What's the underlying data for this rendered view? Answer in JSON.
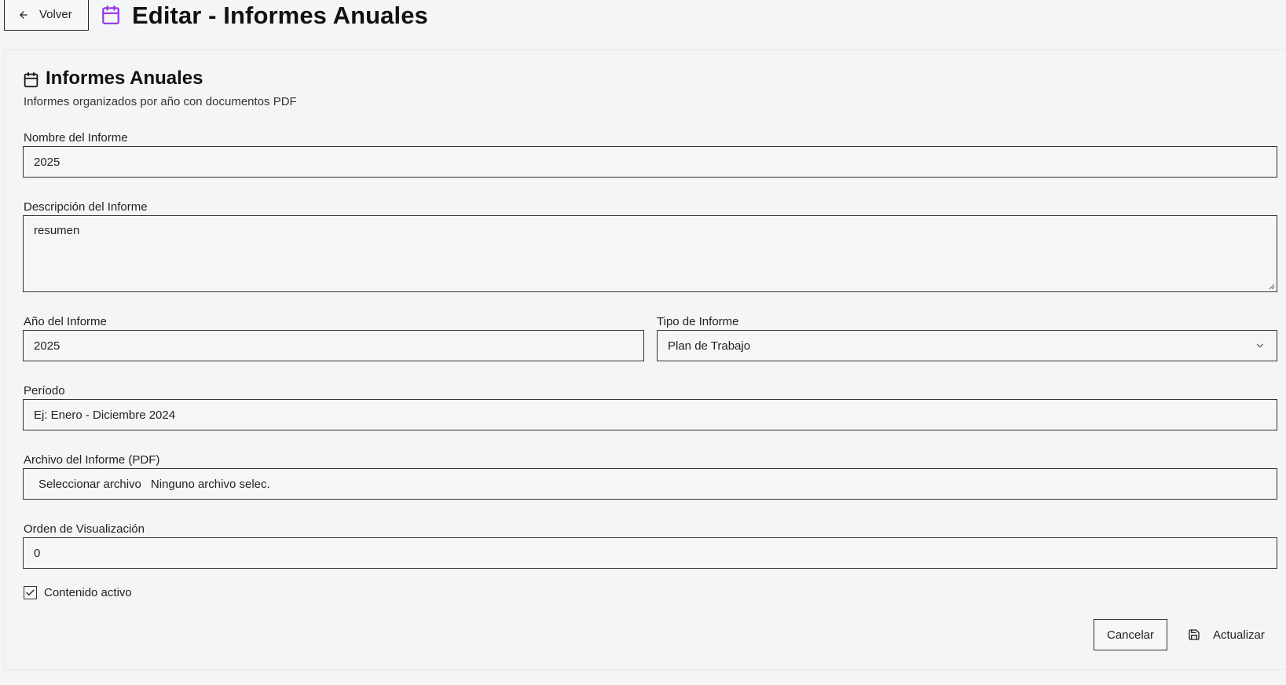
{
  "header": {
    "back_label": "Volver",
    "title": "Editar - Informes Anuales",
    "title_icon": "calendar-icon",
    "accent_color": "#9333ea"
  },
  "card": {
    "title": "Informes Anuales",
    "description": "Informes organizados por año con documentos PDF",
    "icon": "calendar-icon"
  },
  "form": {
    "name": {
      "label": "Nombre del Informe",
      "value": "2025"
    },
    "description": {
      "label": "Descripción del Informe",
      "value": "resumen"
    },
    "year": {
      "label": "Año del Informe",
      "value": "2025"
    },
    "type": {
      "label": "Tipo de Informe",
      "value": "Plan de Trabajo"
    },
    "period": {
      "label": "Período",
      "placeholder": "Ej: Enero - Diciembre 2024"
    },
    "file": {
      "label": "Archivo del Informe (PDF)",
      "button": "Seleccionar archivo",
      "status": "Ninguno archivo selec."
    },
    "order": {
      "label": "Orden de Visualización",
      "value": "0"
    },
    "active": {
      "label": "Contenido activo",
      "checked": true
    }
  },
  "actions": {
    "cancel": "Cancelar",
    "update": "Actualizar",
    "update_icon": "save-icon"
  }
}
